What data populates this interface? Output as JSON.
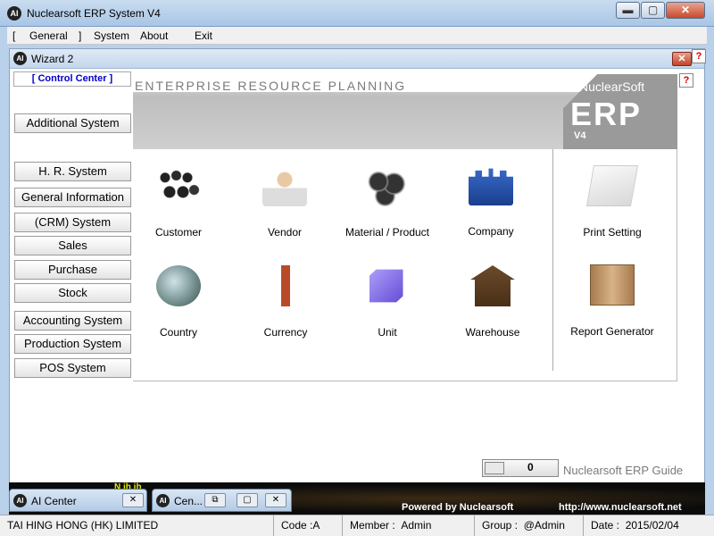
{
  "window": {
    "title": "Nuclearsoft ERP System V4",
    "min": "▬",
    "max": "▢",
    "close": "✕"
  },
  "menu": {
    "bracket_open": "[",
    "general": "General",
    "bracket_close": "]",
    "system": "System",
    "about": "About",
    "exit": "Exit"
  },
  "wizard": {
    "title": "Wizard 2",
    "close": "✕",
    "help": "?",
    "control_center": "[ Control Center ]",
    "nav": [
      "Additional System",
      "H. R. System",
      "General Information",
      "(CRM) System",
      "Sales",
      "Purchase",
      "Stock",
      "Accounting System",
      "Production System",
      "POS System"
    ],
    "banner": {
      "text": "ENTERPRISE RESOURCE PLANNING",
      "brand": "NuclearSoft",
      "erp": "ERP",
      "version": "V4"
    },
    "tiles": [
      {
        "label": "Customer",
        "icon": "customer-group-icon"
      },
      {
        "label": "Vendor",
        "icon": "vendor-person-icon"
      },
      {
        "label": "Material / Product",
        "icon": "material-wheels-icon"
      },
      {
        "label": "Company",
        "icon": "company-castle-icon"
      },
      {
        "label": "Print Setting",
        "icon": "print-paper-icon"
      },
      {
        "label": "Country",
        "icon": "globe-icon"
      },
      {
        "label": "Currency",
        "icon": "currency-icon"
      },
      {
        "label": "Unit",
        "icon": "cube-icon"
      },
      {
        "label": "Warehouse",
        "icon": "warehouse-icon"
      },
      {
        "label": "Report Generator",
        "icon": "report-book-icon"
      }
    ],
    "guide": {
      "value": "0",
      "label": "Nuclearsoft ERP Guide"
    }
  },
  "strip": {
    "small": "N ih ih",
    "powered": "Powered by Nuclearsoft",
    "url": "http://www.nuclearsoft.net"
  },
  "tabs": [
    {
      "label": "AI Center",
      "close": "✕"
    },
    {
      "label": "Cen...",
      "restore": "⧉",
      "max": "▢",
      "close": "✕"
    }
  ],
  "status": {
    "company": "TAI HING HONG (HK) LIMITED",
    "code": "Code :A",
    "member_label": "Member :",
    "member": "Admin",
    "group_label": "Group :",
    "group": "@Admin",
    "date_label": "Date :",
    "date": "2015/02/04"
  }
}
